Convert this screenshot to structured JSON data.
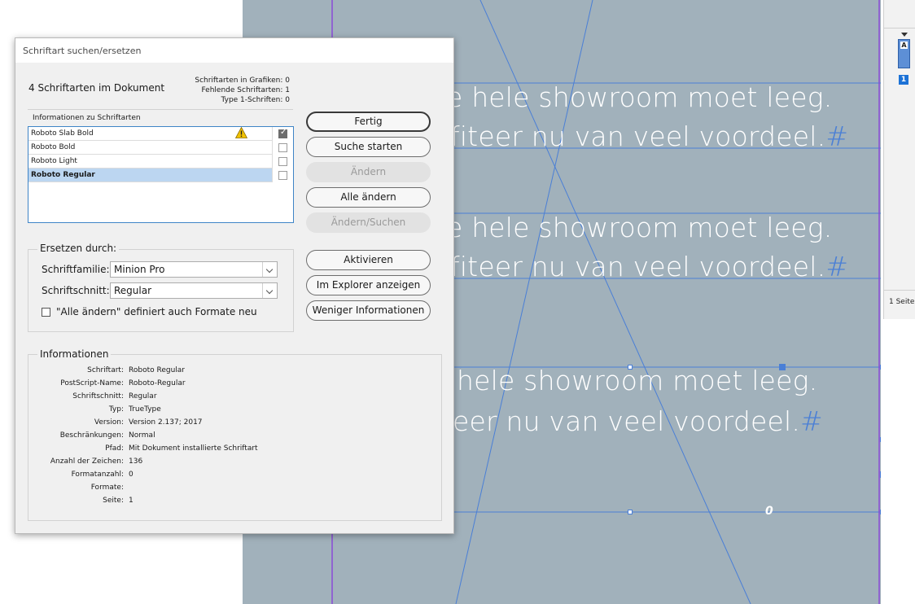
{
  "canvas": {
    "lines": [
      {
        "text": "e hele showroom moet leeg.",
        "hash": false
      },
      {
        "text": "fiteer nu van veel voordeel.",
        "hash": true
      },
      {
        "text": "e hele showroom moet leeg.",
        "hash": false
      },
      {
        "text": "fiteer nu van veel voordeel.",
        "hash": true
      },
      {
        "text": "hele showroom moet leeg.",
        "hash": false
      },
      {
        "text": "eer nu van veel voordeel.",
        "hash": true
      }
    ],
    "hash_symbol": "#",
    "overset_symbol": "0"
  },
  "pages_panel": {
    "master_letter": "A",
    "page_number": "1",
    "page_count": "1 Seite"
  },
  "dialog": {
    "title": "Schriftart suchen/ersetzen",
    "summary": "4 Schriftarten im Dokument",
    "stats": {
      "graphics": "Schriftarten in Grafiken: 0",
      "missing": "Fehlende Schriftarten: 1",
      "type1": "Type 1-Schriften: 0"
    },
    "font_info_header": "Informationen zu Schriftarten",
    "fonts": [
      {
        "name": "Roboto Slab Bold",
        "warning": true,
        "checked": true
      },
      {
        "name": "Roboto Bold",
        "warning": false,
        "checked": false
      },
      {
        "name": "Roboto Light",
        "warning": false,
        "checked": false
      },
      {
        "name": "Roboto Regular",
        "warning": false,
        "checked": false,
        "selected": true
      }
    ],
    "buttons": {
      "done": "Fertig",
      "find_first": "Suche starten",
      "change": "Ändern",
      "change_all": "Alle ändern",
      "change_find": "Ändern/Suchen",
      "activate": "Aktivieren",
      "reveal": "Im Explorer anzeigen",
      "less_info": "Weniger Informationen"
    },
    "replace": {
      "title": "Ersetzen durch:",
      "family_label": "Schriftfamilie:",
      "family_value": "Minion Pro",
      "style_label": "Schriftschnitt:",
      "style_value": "Regular",
      "redefine_label": "\"Alle ändern\" definiert auch Formate neu"
    },
    "info": {
      "title": "Informationen",
      "rows": [
        {
          "label": "Schriftart:",
          "value": "Roboto Regular"
        },
        {
          "label": "PostScript-Name:",
          "value": "Roboto-Regular"
        },
        {
          "label": "Schriftschnitt:",
          "value": "Regular"
        },
        {
          "label": "Typ:",
          "value": "TrueType"
        },
        {
          "label": "Version:",
          "value": "Version 2.137; 2017"
        },
        {
          "label": "Beschränkungen:",
          "value": "Normal"
        },
        {
          "label": "Pfad:",
          "value": "Mit Dokument installierte Schriftart"
        },
        {
          "label": "Anzahl der Zeichen:",
          "value": "136"
        },
        {
          "label": "Formatanzahl:",
          "value": "0"
        },
        {
          "label": "Formate:",
          "value": ""
        },
        {
          "label": "Seite:",
          "value": "1"
        }
      ]
    }
  },
  "colors": {
    "canvas": "#a1b1bb",
    "guide": "#4a7fd6",
    "margin_purple": "#8a4bd8",
    "selection": "#3f85c7"
  }
}
